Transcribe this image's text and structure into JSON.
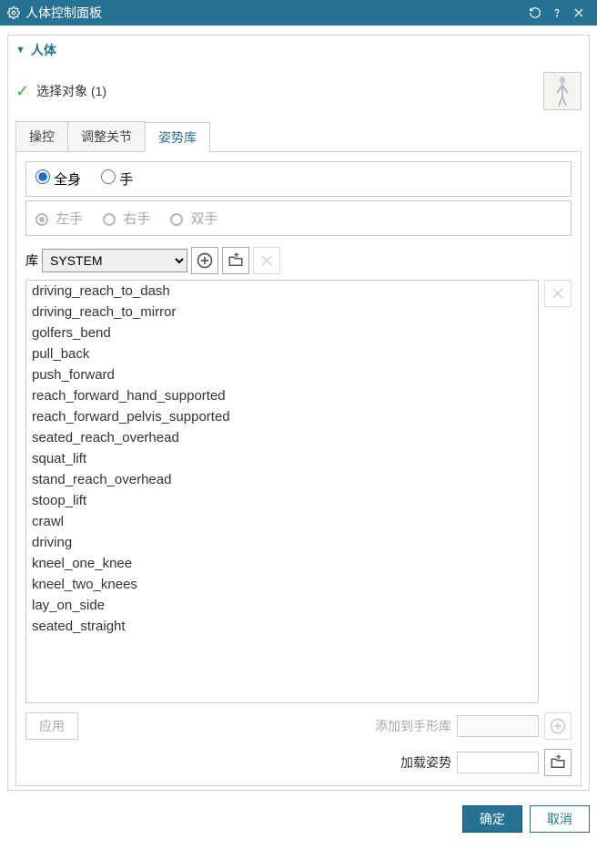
{
  "window": {
    "title": "人体控制面板"
  },
  "panel": {
    "header": "人体",
    "selection": {
      "label": "选择对象 (1)"
    }
  },
  "tabs": {
    "t1": "操控",
    "t2": "调整关节",
    "t3": "姿势库"
  },
  "scope": {
    "full_body": "全身",
    "hand": "手",
    "left_hand": "左手",
    "right_hand": "右手",
    "both_hands": "双手"
  },
  "library": {
    "label": "库",
    "selected": "SYSTEM"
  },
  "poses": [
    "driving_reach_to_dash",
    "driving_reach_to_mirror",
    "golfers_bend",
    "pull_back",
    "push_forward",
    "reach_forward_hand_supported",
    "reach_forward_pelvis_supported",
    "seated_reach_overhead",
    "squat_lift",
    "stand_reach_overhead",
    "stoop_lift",
    "crawl",
    "driving",
    "kneel_one_knee",
    "kneel_two_knees",
    "lay_on_side",
    "seated_straight"
  ],
  "buttons": {
    "apply": "应用",
    "add_to_hand_lib": "添加到手形库",
    "load_pose": "加载姿势",
    "ok": "确定",
    "cancel": "取消"
  }
}
